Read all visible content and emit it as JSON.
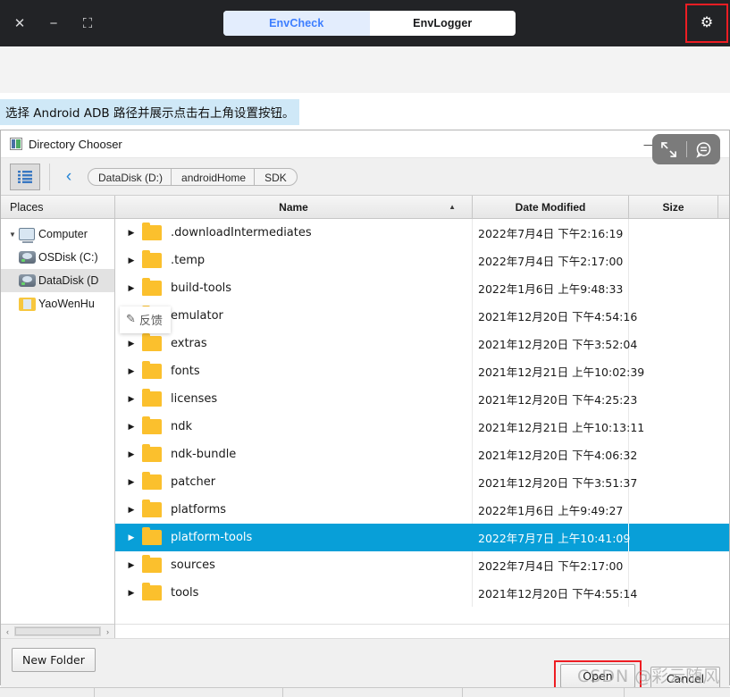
{
  "app": {
    "window_controls": [
      {
        "name": "close",
        "glyph": "✕"
      },
      {
        "name": "minimize",
        "glyph": "−"
      },
      {
        "name": "maximize",
        "glyph": "⛶"
      }
    ],
    "tabs": [
      {
        "label": "EnvCheck",
        "active": true
      },
      {
        "label": "EnvLogger",
        "active": false
      }
    ],
    "settings_icon": "gear-icon",
    "settings_glyph": "⚙",
    "highlight_color": "#ee1d23",
    "titlebar_color": "#222326",
    "active_tab_bg": "#e3edfd",
    "active_tab_text": "#3d7eff"
  },
  "caption": {
    "text": "选择 Android ADB 路径并展示点击右上角设置按钮。",
    "bg": "#cfe8f7"
  },
  "dialog": {
    "title": "Directory Chooser",
    "window_controls": [
      {
        "name": "minimize",
        "glyph": "—"
      },
      {
        "name": "maximize",
        "glyph": "□"
      },
      {
        "name": "close",
        "glyph": "✕"
      }
    ],
    "capture_overlay": {
      "expand_icon": "expand-arrows-icon",
      "expand_glyph": "⤡",
      "feedback_icon": "feedback-bubble-icon",
      "feedback_glyph": "💬",
      "bg": "#7b7b7b"
    },
    "toolbar": {
      "view_icon": "list-view-icon",
      "back_icon": "chevron-left-icon",
      "back_glyph": "‹",
      "breadcrumbs": [
        "DataDisk (D:)",
        "androidHome",
        "SDK"
      ]
    },
    "columns": {
      "places": "Places",
      "name": "Name",
      "date_modified": "Date Modified",
      "size": "Size",
      "sort_glyph": "▲",
      "sorted_by": "Name"
    },
    "places": [
      {
        "label": "Computer",
        "icon": "monitor-icon",
        "twisty": "▼",
        "indent": 0,
        "selected": false
      },
      {
        "label": "OSDisk (C:)",
        "icon": "drive-icon",
        "twisty": "",
        "indent": 1,
        "selected": false
      },
      {
        "label": "DataDisk (D",
        "icon": "drive-icon",
        "twisty": "",
        "indent": 1,
        "selected": true
      },
      {
        "label": "YaoWenHu",
        "icon": "user-folder-icon",
        "twisty": "",
        "indent": 1,
        "selected": false
      }
    ],
    "files": [
      {
        "name": ".downloadIntermediates",
        "date": "2022年7月4日 下午2:16:19",
        "size": "",
        "selected": false
      },
      {
        "name": ".temp",
        "date": "2022年7月4日 下午2:17:00",
        "size": "",
        "selected": false
      },
      {
        "name": "build-tools",
        "date": "2022年1月6日 上午9:48:33",
        "size": "",
        "selected": false
      },
      {
        "name": "emulator",
        "date": "2021年12月20日 下午4:54:16",
        "size": "",
        "selected": false
      },
      {
        "name": "extras",
        "date": "2021年12月20日 下午3:52:04",
        "size": "",
        "selected": false
      },
      {
        "name": "fonts",
        "date": "2021年12月21日 上午10:02:39",
        "size": "",
        "selected": false
      },
      {
        "name": "licenses",
        "date": "2021年12月20日 下午4:25:23",
        "size": "",
        "selected": false
      },
      {
        "name": "ndk",
        "date": "2021年12月21日 上午10:13:11",
        "size": "",
        "selected": false
      },
      {
        "name": "ndk-bundle",
        "date": "2021年12月20日 下午4:06:32",
        "size": "",
        "selected": false
      },
      {
        "name": "patcher",
        "date": "2021年12月20日 下午3:51:37",
        "size": "",
        "selected": false
      },
      {
        "name": "platforms",
        "date": "2022年1月6日 上午9:49:27",
        "size": "",
        "selected": false
      },
      {
        "name": "platform-tools",
        "date": "2022年7月7日 上午10:41:09",
        "size": "",
        "selected": true
      },
      {
        "name": "sources",
        "date": "2022年7月4日 下午2:17:00",
        "size": "",
        "selected": false
      },
      {
        "name": "tools",
        "date": "2021年12月20日 下午4:55:14",
        "size": "",
        "selected": false
      }
    ],
    "selection_color": "#089fd8",
    "feedback_tooltip": {
      "label": "反馈",
      "icon": "edit-feedback-icon",
      "glyph": "✎"
    },
    "footer": {
      "new_folder": "New Folder",
      "open": "Open",
      "cancel": "Cancel"
    }
  },
  "watermark": {
    "csdn": "CSDN",
    "author": "@彩云随风"
  }
}
